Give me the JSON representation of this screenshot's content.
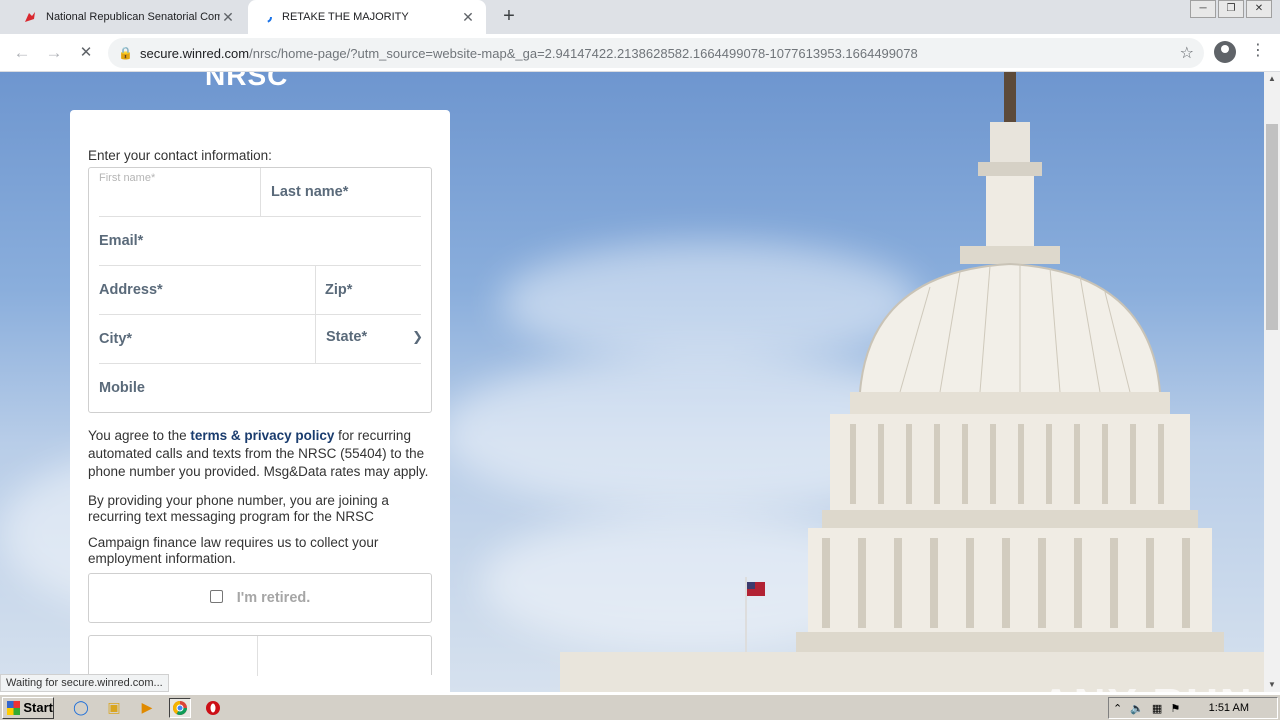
{
  "browser": {
    "tabs": [
      {
        "title": "National Republican Senatorial Comm",
        "close": "✕"
      },
      {
        "title": "RETAKE THE MAJORITY",
        "close": "✕"
      }
    ],
    "new_tab": "+",
    "url_host": "secure.winred.com",
    "url_path": "/nrsc/home-page/?utm_source=website-map&_ga=2.94147422.2138628582.1664499078-1077613953.1664499078",
    "status_text": "Waiting for secure.winred.com..."
  },
  "page": {
    "logo_text": "NRSC",
    "intro": "Enter your contact information:",
    "fields": {
      "first_name": "First name*",
      "last_name": "Last name*",
      "email": "Email*",
      "address": "Address*",
      "zip": "Zip*",
      "city": "City*",
      "state": "State*",
      "mobile": "Mobile"
    },
    "legal_prefix": "You agree to the ",
    "legal_link": "terms & privacy policy",
    "legal_suffix": " for recurring automated calls and texts from the NRSC (55404) to the phone number you provided. Msg&Data rates may apply.",
    "sms_notice": "By providing your phone number, you are joining a recurring text messaging program for the NRSC",
    "employment_notice": "Campaign finance law requires us to collect your employment information.",
    "retired_label": "I'm retired."
  },
  "watermark": "ANY RUN",
  "taskbar": {
    "start_label": "Start",
    "clock": "1:51 AM"
  }
}
